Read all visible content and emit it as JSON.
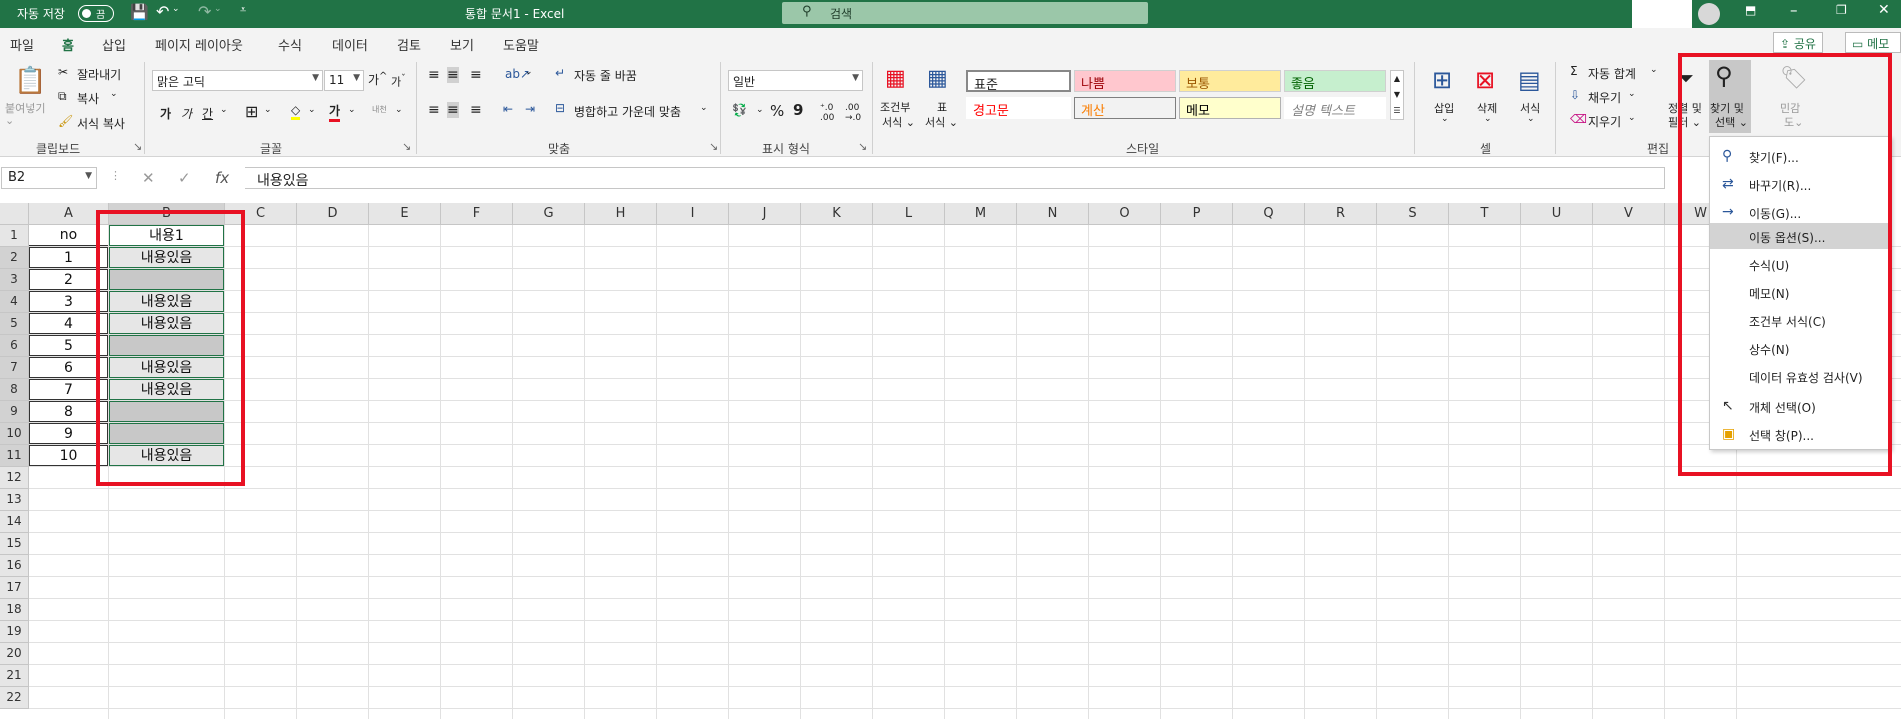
{
  "titlebar": {
    "autosave_label": "자동 저장",
    "autosave_state": "끔",
    "title": "통합 문서1  -  Excel",
    "search_placeholder": "검색"
  },
  "tabs": [
    "파일",
    "홈",
    "삽입",
    "페이지 레이아웃",
    "수식",
    "데이터",
    "검토",
    "보기",
    "도움말"
  ],
  "active_tab": "홈",
  "share_button": "공유",
  "memo_button": "메모",
  "ribbon": {
    "clipboard": {
      "paste": "붙여넣기",
      "cut": "잘라내기",
      "copy": "복사",
      "format_painter": "서식 복사",
      "group": "클립보드"
    },
    "font": {
      "name": "맑은 고딕",
      "size": "11",
      "group": "글꼴",
      "bold": "가",
      "italic": "가",
      "underline": "간",
      "grow": "가",
      "shrink": "가",
      "phonetic": "내천"
    },
    "alignment": {
      "wrap": "자동 줄 바꿈",
      "merge": "병합하고 가운데 맞춤",
      "group": "맞춤"
    },
    "number": {
      "format": "일반",
      "group": "표시 형식",
      "percent": "%",
      "comma": "9"
    },
    "styles": {
      "conditional": "조건부\n서식",
      "table": "표\n서식",
      "group": "스타일",
      "cells": [
        {
          "label": "표준",
          "color": "#000000",
          "bg": "#ffffff"
        },
        {
          "label": "나쁨",
          "color": "#9c0006",
          "bg": "#ffc7ce"
        },
        {
          "label": "보통",
          "color": "#9c5700",
          "bg": "#ffeb9c"
        },
        {
          "label": "좋음",
          "color": "#006100",
          "bg": "#c6efce"
        },
        {
          "label": "경고문",
          "color": "#ff0000",
          "bg": "#ffffff"
        },
        {
          "label": "계산",
          "color": "#fa7d00",
          "bg": "#f2f2f2"
        },
        {
          "label": "메모",
          "color": "#000000",
          "bg": "#ffffcc"
        },
        {
          "label": "설명 텍스트",
          "color": "#7f7f7f",
          "bg": "#ffffff"
        }
      ]
    },
    "cells_group": {
      "insert": "삽입",
      "delete": "삭제",
      "format": "서식",
      "group": "셀"
    },
    "editing": {
      "autosum": "자동 합계",
      "fill": "채우기",
      "clear": "지우기",
      "sort_filter_a": "정렬 및",
      "sort_filter_b": "필터",
      "find_select_a": "찾기 및",
      "find_select_b": "선택",
      "sensitivity_a": "민감",
      "sensitivity_b": "도",
      "group": "편집"
    }
  },
  "formula_bar": {
    "name_box": "B2",
    "value": "내용있음",
    "cancel": "✕",
    "enter": "✓",
    "fx": "fx"
  },
  "columns": [
    "A",
    "B",
    "C",
    "D",
    "E",
    "F",
    "G",
    "H",
    "I",
    "J",
    "K",
    "L",
    "M",
    "N",
    "O",
    "P",
    "Q",
    "R",
    "S",
    "T",
    "U",
    "V",
    "W"
  ],
  "rows": [
    "1",
    "2",
    "3",
    "4",
    "5",
    "6",
    "7",
    "8",
    "9",
    "10",
    "11",
    "12",
    "13",
    "14",
    "15",
    "16",
    "17",
    "18",
    "19",
    "20",
    "21",
    "22"
  ],
  "sheet": {
    "A": [
      "no",
      "1",
      "2",
      "3",
      "4",
      "5",
      "6",
      "7",
      "8",
      "9",
      "10"
    ],
    "B": [
      "내용1",
      "내용있음",
      "",
      "내용있음",
      "내용있음",
      "",
      "내용있음",
      "내용있음",
      "",
      "",
      "내용있음"
    ]
  },
  "menu": [
    {
      "label": "찾기(F)...",
      "icon": "search-icon"
    },
    {
      "label": "바꾸기(R)...",
      "icon": "replace-icon"
    },
    {
      "label": "이동(G)...",
      "icon": "arrow-right-icon"
    },
    {
      "label": "이동 옵션(S)...",
      "icon": "",
      "highlighted": true
    },
    {
      "label": "수식(U)",
      "icon": ""
    },
    {
      "label": "메모(N)",
      "icon": ""
    },
    {
      "label": "조건부 서식(C)",
      "icon": ""
    },
    {
      "label": "상수(N)",
      "icon": ""
    },
    {
      "label": "데이터 유효성 검사(V)",
      "icon": ""
    },
    {
      "label": "개체 선택(O)",
      "icon": "cursor-icon"
    },
    {
      "label": "선택 창(P)...",
      "icon": "selection-pane-icon"
    }
  ],
  "colors": {
    "excel_green": "#217346",
    "highlight_red": "#e81123",
    "empty_cell_fill": "#c8c8c8"
  }
}
